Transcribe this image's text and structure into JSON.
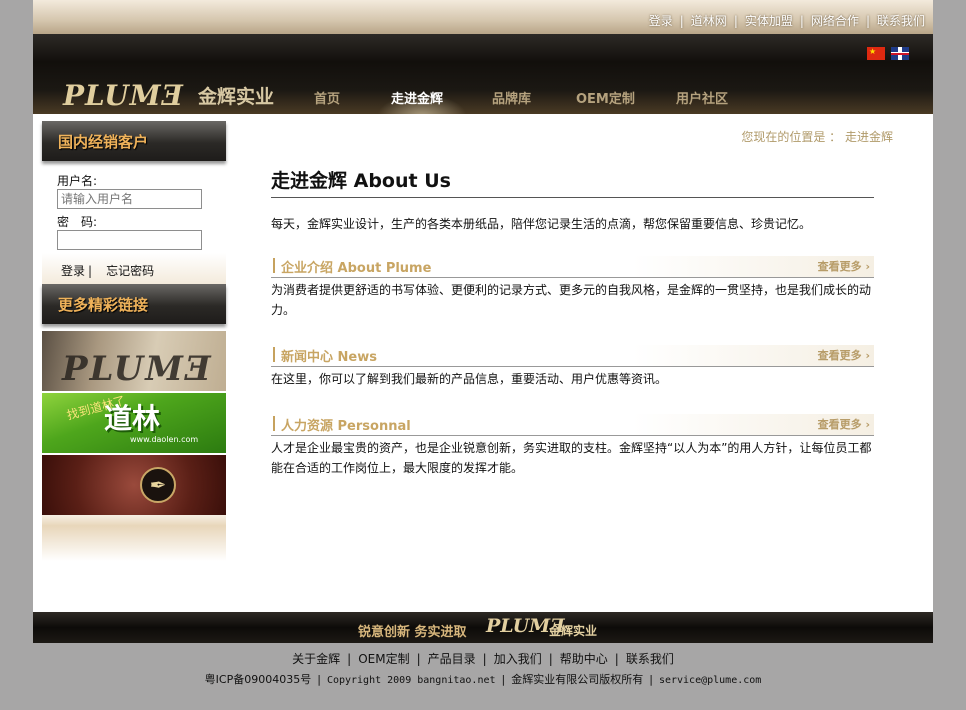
{
  "top_links": [
    "登录",
    "道林网",
    "实体加盟",
    "网络合作",
    "联系我们"
  ],
  "top_sep": "|",
  "logo": {
    "en": "PLUMƎ",
    "cn": "金辉实业"
  },
  "nav": [
    "首页",
    "走进金辉",
    "品牌库",
    "OEM定制",
    "用户社区"
  ],
  "sidebar": {
    "dealer_title": "国内经销客户",
    "username_label": "用户名:",
    "username_placeholder": "请输入用户名",
    "password_label": "密　码:",
    "login_label": "登录",
    "login_sep": "|",
    "forgot_label": "忘记密码",
    "links_title": "更多精彩链接",
    "banner_plume_text": "PLUMƎ",
    "banner_daolin_slogan": "找到道林了",
    "banner_daolin_name": "道林",
    "banner_daolin_url": "www.daolen.com"
  },
  "breadcrumb": "您现在的位置是 ： 走进金辉",
  "main": {
    "title": "走进金辉  About  Us",
    "intro": "每天，金辉实业设计，生产的各类本册纸品，陪伴您记录生活的点滴，帮您保留重要信息、珍贵记忆。",
    "more_label": "查看更多 ›",
    "sections": [
      {
        "title": "企业介绍  About Plume",
        "body": "为消费者提供更舒适的书写体验、更便利的记录方式、更多元的自我风格，是金辉的一贯坚持，也是我们成长的动力。"
      },
      {
        "title": "新闻中心  News",
        "body": "在这里，你可以了解到我们最新的产品信息，重要活动、用户优惠等资讯。"
      },
      {
        "title": "人力资源  Personnal",
        "body": "人才是企业最宝贵的资产，也是企业锐意创新，务实进取的支柱。金辉坚持“以人为本”的用人方针，让每位员工都能在合适的工作岗位上，最大限度的发挥才能。"
      }
    ]
  },
  "footer": {
    "slogan": "锐意创新  务实进取",
    "logo_en": "PLUMƎ",
    "logo_cn": "金辉实业",
    "links": [
      "关于金辉",
      "OEM定制",
      "产品目录",
      "加入我们",
      "帮助中心",
      "联系我们"
    ],
    "icp": "粤ICP备09004035号",
    "copyright": "Copyright 2009 bangnitao.net",
    "company": "金辉实业有限公司版权所有",
    "email": "service@plume.com"
  }
}
